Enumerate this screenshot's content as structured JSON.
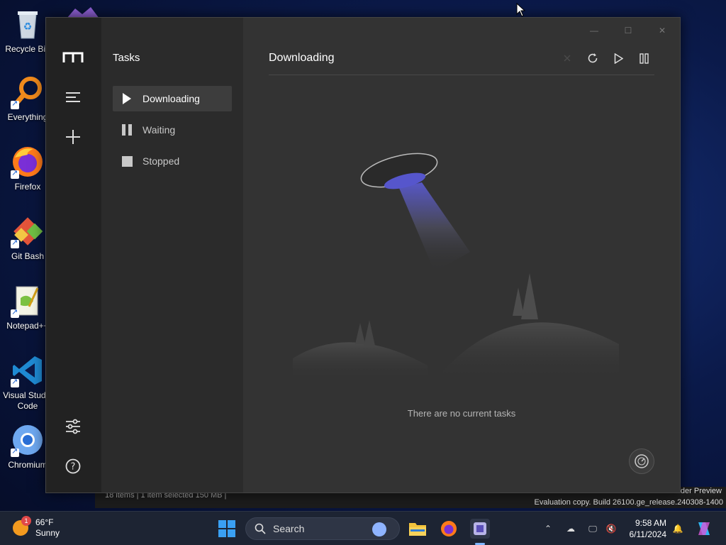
{
  "desktop": {
    "icons": [
      {
        "label": "Recycle Bin",
        "icon": "recycle-bin-icon"
      },
      {
        "label": "Everything",
        "icon": "magnifier-icon"
      },
      {
        "label": "Firefox",
        "icon": "firefox-icon"
      },
      {
        "label": "Git Bash",
        "icon": "git-icon"
      },
      {
        "label": "Notepad++",
        "icon": "notepad-icon"
      },
      {
        "label": "Visual Studio Code",
        "icon": "vscode-icon"
      },
      {
        "label": "Chromium",
        "icon": "chromium-icon"
      }
    ]
  },
  "background_window": {
    "status": "18 items  |  1 item selected  150 MB  |",
    "line1": "Insider Preview",
    "line2": "Evaluation copy. Build 26100.ge_release.240308-1400"
  },
  "app": {
    "rail": {
      "logo": "motrix-logo-icon",
      "menu": "menu-icon",
      "add": "plus-icon",
      "settings": "sliders-icon",
      "help": "help-icon"
    },
    "nav": {
      "title": "Tasks",
      "items": [
        {
          "label": "Downloading",
          "icon": "play-icon",
          "active": true
        },
        {
          "label": "Waiting",
          "icon": "pause-icon",
          "active": false
        },
        {
          "label": "Stopped",
          "icon": "stop-icon",
          "active": false
        }
      ]
    },
    "main": {
      "title": "Downloading",
      "empty_text": "There are no current tasks"
    },
    "toolbar": [
      "close-icon",
      "refresh-icon",
      "play-icon",
      "pause-icon"
    ],
    "colors": {
      "rail": "#222222",
      "nav": "#2b2b2b",
      "main": "#333333",
      "active": "#3d3d3d",
      "beam": "#5b5bd6"
    }
  },
  "taskbar": {
    "weather": {
      "badge": "1",
      "temp": "66°F",
      "condition": "Sunny"
    },
    "search_placeholder": "Search",
    "clock": {
      "time": "9:58 AM",
      "date": "6/11/2024"
    }
  }
}
